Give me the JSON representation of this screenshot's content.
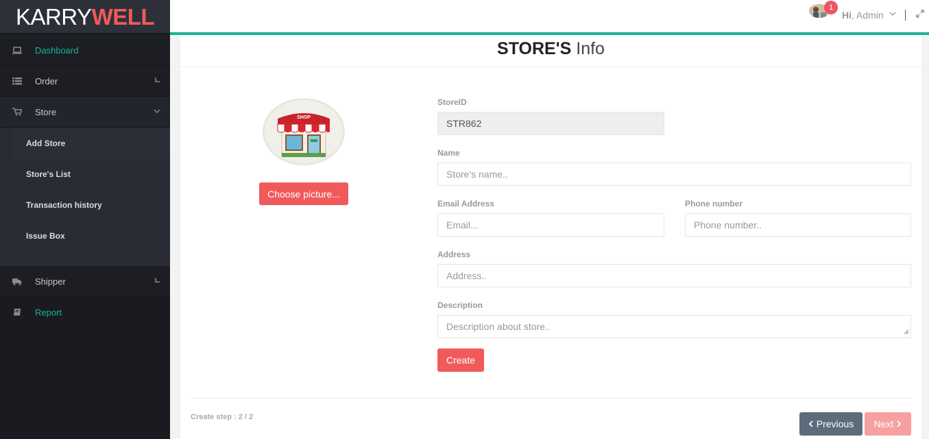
{
  "brand": {
    "part1": "KARRY",
    "part2": "WELL"
  },
  "sidebar": {
    "items": [
      {
        "label": "Dashboard",
        "icon": "laptop-icon"
      },
      {
        "label": "Order",
        "icon": "list-icon"
      },
      {
        "label": "Store",
        "icon": "cart-icon"
      },
      {
        "label": "Shipper",
        "icon": "truck-icon"
      },
      {
        "label": "Report",
        "icon": "book-icon"
      }
    ],
    "store_submenu": [
      "Add Store",
      "Store's List",
      "Transaction history",
      "Issue Box"
    ]
  },
  "topbar": {
    "notification_count": "1",
    "greeting_hi": "Hi",
    "greeting_name": ", Admin"
  },
  "page": {
    "title_bold": "STORE'S",
    "title_light": " Info"
  },
  "form": {
    "choose_picture": "Choose picture...",
    "storeid_label": "StoreID",
    "storeid_value": "STR862",
    "name_label": "Name",
    "name_placeholder": "Store's name..",
    "email_label": "Email Address",
    "email_placeholder": "Email...",
    "phone_label": "Phone number",
    "phone_placeholder": "Phone number..",
    "address_label": "Address",
    "address_placeholder": "Address..",
    "description_label": "Description",
    "description_placeholder": "Description about store..",
    "create_label": "Create",
    "shop_sign": "SHOP"
  },
  "wizard": {
    "step_text": "Create step : 2 / 2",
    "prev_label": "Previous",
    "next_label": "Next"
  },
  "colors": {
    "accent": "#1ab394",
    "brand_red": "#f05a5b",
    "sidebar_bg": "#191b20"
  }
}
